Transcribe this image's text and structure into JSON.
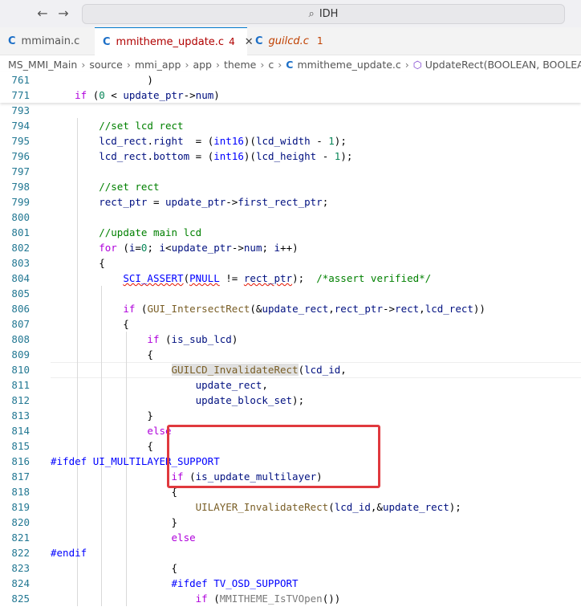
{
  "titlebar": {
    "search_text": "IDH",
    "back_icon": "arrow-left-icon",
    "forward_icon": "arrow-right-icon"
  },
  "tabs": [
    {
      "lang": "C",
      "name": "mmimain.c",
      "count": "",
      "state": "normal"
    },
    {
      "lang": "C",
      "name": "mmitheme_update.c",
      "count": "4",
      "state": "active"
    },
    {
      "lang": "C",
      "name": "guilcd.c",
      "count": "1",
      "state": "error"
    }
  ],
  "breadcrumb": {
    "parts": [
      "MS_MMI_Main",
      "source",
      "mmi_app",
      "app",
      "theme",
      "c"
    ],
    "file_lang": "C",
    "file": "mmitheme_update.c",
    "symbol": "UpdateRect(BOOLEAN, BOOLEAN, u"
  },
  "sticky": [
    {
      "n": "761",
      "text": "                )"
    },
    {
      "n": "771",
      "text": "    if (0 < update_ptr->num)"
    }
  ],
  "lines": [
    {
      "n": "793",
      "text": ""
    },
    {
      "n": "794",
      "text": "        //set lcd rect"
    },
    {
      "n": "795",
      "text": "        lcd_rect.right  = (int16)(lcd_width - 1);"
    },
    {
      "n": "796",
      "text": "        lcd_rect.bottom = (int16)(lcd_height - 1);"
    },
    {
      "n": "797",
      "text": ""
    },
    {
      "n": "798",
      "text": "        //set rect"
    },
    {
      "n": "799",
      "text": "        rect_ptr = update_ptr->first_rect_ptr;"
    },
    {
      "n": "800",
      "text": ""
    },
    {
      "n": "801",
      "text": "        //update main lcd"
    },
    {
      "n": "802",
      "text": "        for (i=0; i<update_ptr->num; i++)"
    },
    {
      "n": "803",
      "text": "        {"
    },
    {
      "n": "804",
      "text": "            SCI_ASSERT(PNULL != rect_ptr);  /*assert verified*/"
    },
    {
      "n": "805",
      "text": ""
    },
    {
      "n": "806",
      "text": "            if (GUI_IntersectRect(&update_rect,rect_ptr->rect,lcd_rect))"
    },
    {
      "n": "807",
      "text": "            {"
    },
    {
      "n": "808",
      "text": "                if (is_sub_lcd)"
    },
    {
      "n": "809",
      "text": "                {"
    },
    {
      "n": "810",
      "text": "                    GUILCD_InvalidateRect(lcd_id,"
    },
    {
      "n": "811",
      "text": "                        update_rect,"
    },
    {
      "n": "812",
      "text": "                        update_block_set);"
    },
    {
      "n": "813",
      "text": "                }"
    },
    {
      "n": "814",
      "text": "                else"
    },
    {
      "n": "815",
      "text": "                {"
    },
    {
      "n": "816",
      "text": "#ifdef UI_MULTILAYER_SUPPORT"
    },
    {
      "n": "817",
      "text": "                    if (is_update_multilayer)"
    },
    {
      "n": "818",
      "text": "                    {"
    },
    {
      "n": "819",
      "text": "                        UILAYER_InvalidateRect(lcd_id,&update_rect);"
    },
    {
      "n": "820",
      "text": "                    }"
    },
    {
      "n": "821",
      "text": "                    else"
    },
    {
      "n": "822",
      "text": "#endif"
    },
    {
      "n": "823",
      "text": "                    {"
    },
    {
      "n": "824",
      "text": "                    #ifdef TV_OSD_SUPPORT"
    },
    {
      "n": "825",
      "text": "                        if (MMITHEME_IsTVOpen())"
    }
  ],
  "colors": {
    "accent": "#007acc",
    "line_number": "#237893",
    "keyword": "#0000ff",
    "control": "#af00db",
    "comment": "#008000",
    "number": "#098658",
    "highlight_box": "#e0393e"
  }
}
